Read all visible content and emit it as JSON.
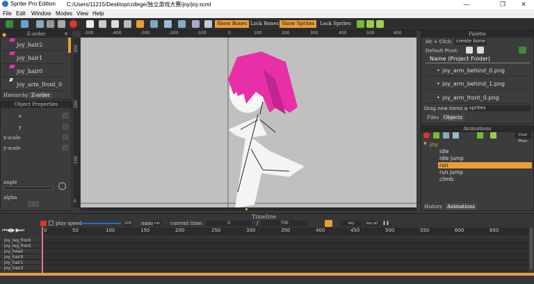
{
  "window": {
    "app_name": "Spriter Pro Edition",
    "file_path": "C:/Users/11215/Desktop/college/独立游戏大赛/joy/joy.scml",
    "controls": [
      "—",
      "❐",
      "✕"
    ]
  },
  "menu": [
    "File",
    "Edit",
    "Window",
    "Modes",
    "View",
    "Help"
  ],
  "toolbar": {
    "show_bones": "Show Bones",
    "lock_bones": "Lock Bones",
    "show_sprites": "Show Sprites",
    "lock_sprites": "Lock Sprites"
  },
  "zorder": {
    "title": "Z-order",
    "items": [
      "joy_hair2",
      "joy_hair1",
      "joy_hair0",
      "joy_arm_front_0"
    ],
    "tabs": [
      "Hierarchy",
      "Z-order"
    ]
  },
  "object_properties": {
    "title": "Object Properties",
    "fields": [
      "x",
      "y",
      "x-scale",
      "y-scale"
    ],
    "angle_label": "angle",
    "alpha_label": "alpha"
  },
  "ruler": {
    "h_labels": [
      "-500",
      "-400",
      "-300",
      "-200",
      "-100",
      "0",
      "100",
      "200",
      "300",
      "400",
      "500",
      "600"
    ],
    "v_labels": [
      "-300",
      "-200",
      "-100",
      "0"
    ]
  },
  "palette": {
    "title": "Palette",
    "alt_click_label": "Alt + Click:",
    "alt_click_value": "create bone",
    "default_pivot_label": "Default Pivot:",
    "column_header": "Name     (Project Folder)",
    "items": [
      "joy_arm_behind_0.png",
      "joy_arm_behind_1.png",
      "joy_arm_front_0.png"
    ],
    "drag_label": "Drag new items as",
    "drag_value": "sprites",
    "tabs": [
      "Files",
      "Objects"
    ]
  },
  "animations": {
    "title": "Animations",
    "clear_maps": "Clear Maps",
    "entity": "joy",
    "items": [
      "idle",
      "idle jump",
      "run",
      "run jump",
      "climb"
    ],
    "selected": "run",
    "tabs": [
      "History",
      "Animations"
    ]
  },
  "timeline": {
    "title": "Timeline",
    "play_speed_label": "play speed",
    "play_speed_value": "100",
    "name_label": "name",
    "name_value": "run",
    "current_time_label": "current time:",
    "current_time_value": "0",
    "slash": "/",
    "end_time": "700",
    "key_selected": "key selected",
    "key_all": "key all",
    "tick_labels": [
      "0",
      "50",
      "100",
      "150",
      "200",
      "250",
      "300",
      "350",
      "400",
      "450",
      "500",
      "550",
      "600",
      "650"
    ],
    "tracks": [
      "joy_leg_front",
      "joy_leg_front",
      "joy_head",
      "joy_hair0",
      "joy_hair1",
      "joy_hair2"
    ]
  },
  "colors": {
    "accent": "#e99c3a",
    "hair": "#e92fa7",
    "canvas": "#c0c0c0"
  }
}
